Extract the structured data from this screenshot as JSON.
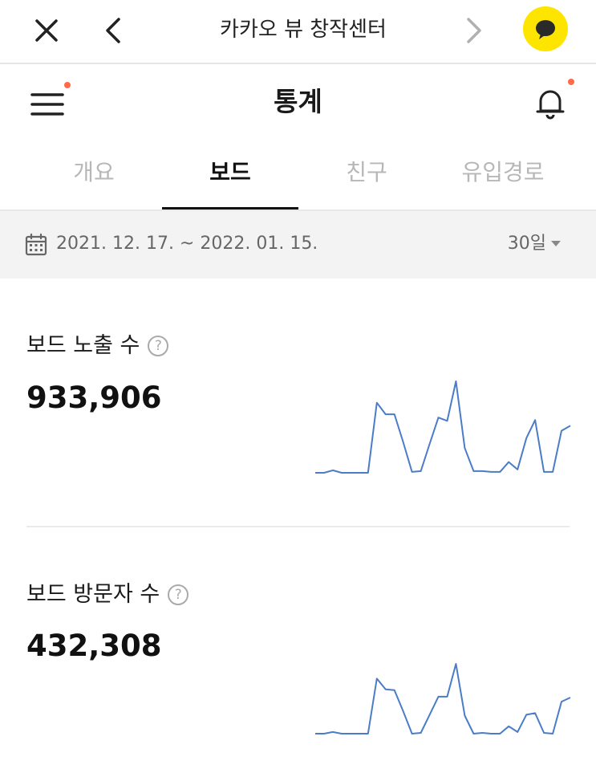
{
  "browser": {
    "title": "카카오 뷰 창작센터",
    "close_icon": "close-icon",
    "back_icon": "chevron-left-icon",
    "forward_icon": "chevron-right-icon",
    "kakao_icon": "kakaotalk-icon"
  },
  "header": {
    "title": "통계",
    "menu_icon": "hamburger-menu-icon",
    "bell_icon": "bell-icon",
    "badge_color": "#ff6b4a"
  },
  "tabs": [
    {
      "label": "개요",
      "active": false
    },
    {
      "label": "보드",
      "active": true
    },
    {
      "label": "친구",
      "active": false
    },
    {
      "label": "유입경로",
      "active": false
    }
  ],
  "date_filter": {
    "range": "2021. 12. 17. ~ 2022. 01. 15.",
    "period": "30일"
  },
  "stats": [
    {
      "label": "보드 노출 수",
      "value": "933,906"
    },
    {
      "label": "보드 방문자 수",
      "value": "432,308"
    }
  ],
  "help_glyph": "?",
  "colors": {
    "accent": "#fee500",
    "line": "#4a7cc7"
  },
  "chart_data": [
    {
      "type": "line",
      "x": [
        1,
        2,
        3,
        4,
        5,
        6,
        7,
        8,
        9,
        10,
        11,
        12,
        13,
        14,
        15,
        16,
        17,
        18,
        19,
        20,
        21,
        22,
        23,
        24,
        25,
        26,
        27,
        28,
        29,
        30
      ],
      "series": [
        {
          "values": [
            1,
            1,
            4,
            1,
            1,
            1,
            1,
            86,
            72,
            72,
            38,
            2,
            3,
            36,
            68,
            64,
            112,
            31,
            3,
            3,
            2,
            2,
            14,
            5,
            43,
            65,
            2,
            2,
            52,
            58
          ]
        }
      ]
    },
    {
      "type": "line",
      "x": [
        1,
        2,
        3,
        4,
        5,
        6,
        7,
        8,
        9,
        10,
        11,
        12,
        13,
        14,
        15,
        16,
        17,
        18,
        19,
        20,
        21,
        22,
        23,
        24,
        25,
        26,
        27,
        28,
        29,
        30
      ],
      "series": [
        {
          "values": [
            1,
            1,
            3,
            1,
            1,
            1,
            1,
            68,
            55,
            54,
            28,
            1,
            2,
            24,
            46,
            46,
            86,
            23,
            1,
            2,
            1,
            1,
            10,
            3,
            24,
            26,
            2,
            1,
            40,
            45
          ]
        }
      ]
    }
  ]
}
